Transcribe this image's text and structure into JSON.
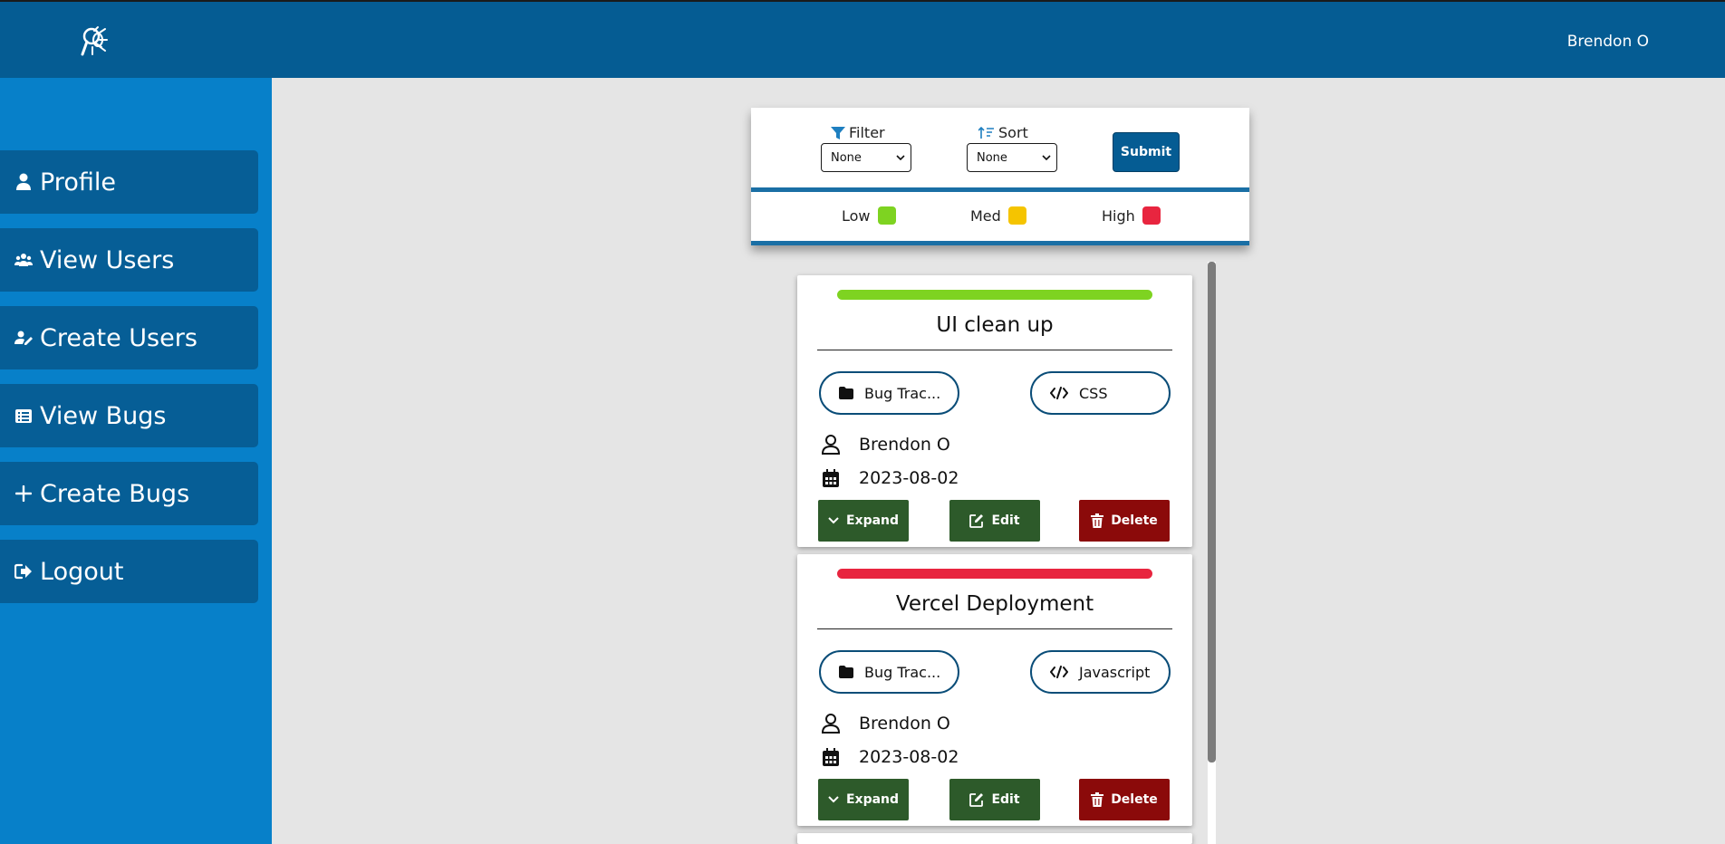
{
  "header": {
    "logo_icon": "bug-logo-icon",
    "user_name": "Brendon O"
  },
  "sidebar": {
    "items": [
      {
        "label": "Profile",
        "icon": "user-icon"
      },
      {
        "label": "View Users",
        "icon": "users-icon"
      },
      {
        "label": "Create Users",
        "icon": "user-edit-icon"
      },
      {
        "label": "View Bugs",
        "icon": "list-icon"
      },
      {
        "label": "Create Bugs",
        "icon": "plus-icon"
      },
      {
        "label": "Logout",
        "icon": "logout-icon"
      }
    ]
  },
  "controls": {
    "filter_label": "Filter",
    "filter_value": "None",
    "sort_label": "Sort",
    "sort_value": "None",
    "submit_label": "Submit"
  },
  "legend": {
    "low": {
      "label": "Low",
      "color": "#7ed321"
    },
    "med": {
      "label": "Med",
      "color": "#f5c400"
    },
    "high": {
      "label": "High",
      "color": "#e8253f"
    }
  },
  "bugs": [
    {
      "priority_color": "#7ed321",
      "title": "UI clean up",
      "project": "Bug Trac...",
      "language": "CSS",
      "assignee": "Brendon O",
      "date": "2023-08-02"
    },
    {
      "priority_color": "#e8253f",
      "title": "Vercel Deployment",
      "project": "Bug Trac...",
      "language": "Javascript",
      "assignee": "Brendon O",
      "date": "2023-08-02"
    }
  ],
  "actions": {
    "expand_label": "Expand",
    "edit_label": "Edit",
    "delete_label": "Delete"
  }
}
